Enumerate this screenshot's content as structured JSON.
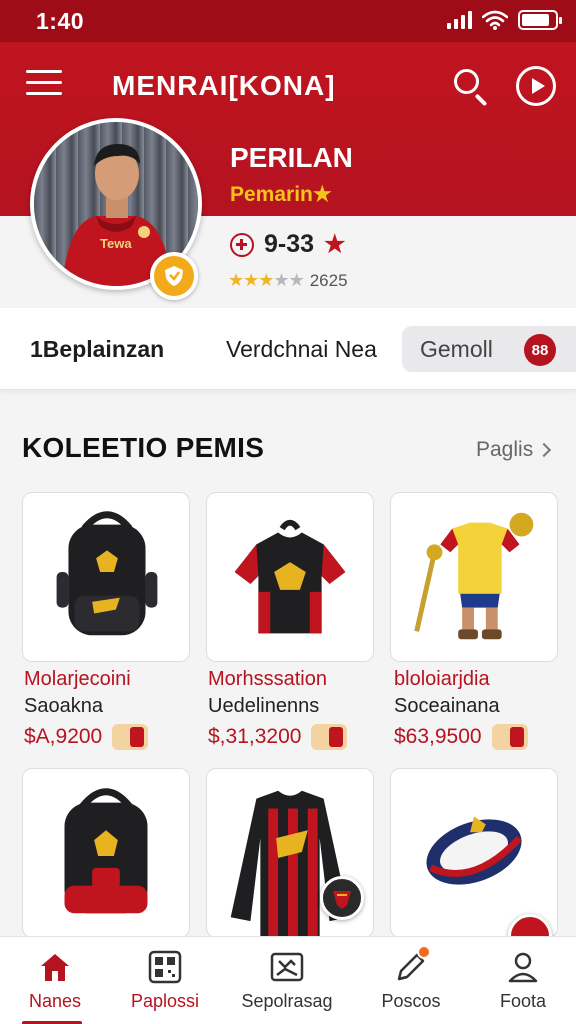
{
  "status_bar": {
    "time": "1:40",
    "battery_level": 0.85
  },
  "header": {
    "title": "MENRAI[KONA]",
    "icons": [
      "menu-icon",
      "search-icon",
      "play-icon"
    ],
    "brand_color": "#b51320"
  },
  "profile": {
    "name": "PERILAN",
    "role": "Pemarin★",
    "stat": "9-33",
    "rating_count": "2625",
    "rating": 3
  },
  "tabs": [
    {
      "label": "1Beplainzan"
    },
    {
      "label": "Verdchnai Nea"
    },
    {
      "label": "Gemoll",
      "count": "88"
    }
  ],
  "collection": {
    "title": "KOLEETIO PEMIS",
    "see_all": "Paglis",
    "items": [
      {
        "name": "Molarjecoini",
        "sub": "Saoakna",
        "price": "$A,9200"
      },
      {
        "name": "Morhsssation",
        "sub": "Uedelinenns",
        "price": "$,31,3200"
      },
      {
        "name": "bloloiarjdia",
        "sub": "Soceainana",
        "price": "$63,9500"
      }
    ]
  },
  "bottom_nav": [
    {
      "label": "Nanes",
      "icon": "home-icon",
      "active": true
    },
    {
      "label": "Paplossi",
      "icon": "qr-code-icon",
      "active": false
    },
    {
      "label": "Sepolrasag",
      "icon": "image-icon",
      "active": false
    },
    {
      "label": "Poscos",
      "icon": "edit-icon",
      "active": false
    },
    {
      "label": "Foota",
      "icon": "user-icon",
      "active": false
    }
  ]
}
